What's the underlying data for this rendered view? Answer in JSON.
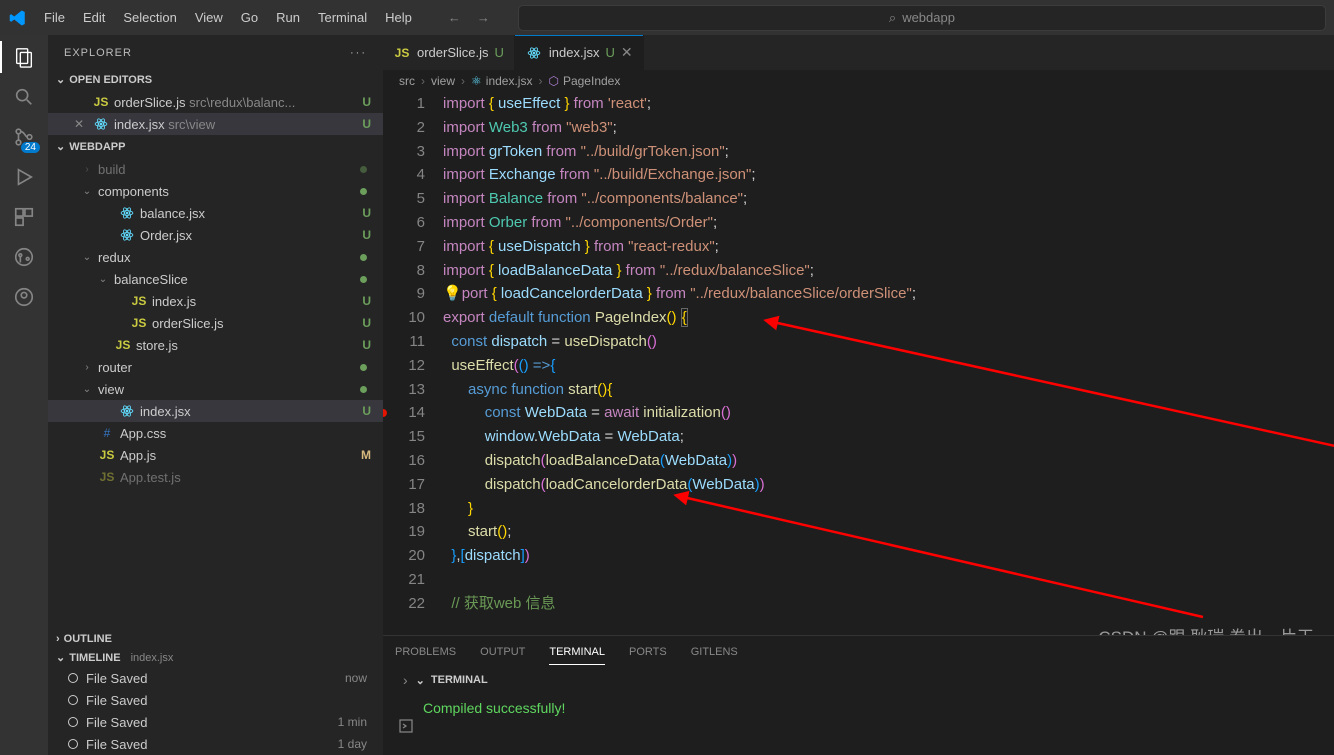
{
  "menubar": [
    "File",
    "Edit",
    "Selection",
    "View",
    "Go",
    "Run",
    "Terminal",
    "Help"
  ],
  "search": {
    "placeholder": "webdapp"
  },
  "activity": {
    "badge": "24"
  },
  "explorer": {
    "title": "EXPLORER",
    "sections": {
      "open_editors": "OPEN EDITORS",
      "workspace": "WEBDAPP",
      "outline": "OUTLINE",
      "timeline": "TIMELINE",
      "timeline_file": "index.jsx"
    },
    "open_items": [
      {
        "icon": "js",
        "name": "orderSlice.js",
        "path": "src\\redux\\balanc...",
        "status": "U"
      },
      {
        "icon": "react",
        "name": "index.jsx",
        "path": "src\\view",
        "status": "U",
        "close": true
      }
    ],
    "tree": [
      {
        "pad": 32,
        "chev": ">",
        "name": "build",
        "dim": true,
        "dot": true
      },
      {
        "pad": 32,
        "chev": "v",
        "name": "components",
        "dot": true
      },
      {
        "pad": 52,
        "icon": "react",
        "name": "balance.jsx",
        "status": "U"
      },
      {
        "pad": 52,
        "icon": "react",
        "name": "Order.jsx",
        "status": "U"
      },
      {
        "pad": 32,
        "chev": "v",
        "name": "redux",
        "dot": true
      },
      {
        "pad": 48,
        "chev": "v",
        "name": "balanceSlice",
        "dot": true
      },
      {
        "pad": 64,
        "icon": "js",
        "name": "index.js",
        "status": "U"
      },
      {
        "pad": 64,
        "icon": "js",
        "name": "orderSlice.js",
        "status": "U"
      },
      {
        "pad": 48,
        "icon": "js",
        "name": "store.js",
        "status": "U"
      },
      {
        "pad": 32,
        "chev": ">",
        "name": "router",
        "dot": true
      },
      {
        "pad": 32,
        "chev": "v",
        "name": "view",
        "dot": true
      },
      {
        "pad": 52,
        "icon": "react",
        "name": "index.jsx",
        "status": "U",
        "selected": true
      },
      {
        "pad": 32,
        "icon": "css",
        "name": "App.css"
      },
      {
        "pad": 32,
        "icon": "js",
        "name": "App.js",
        "status": "M"
      },
      {
        "pad": 32,
        "icon": "js",
        "name": "App.test.js",
        "dim": true
      }
    ],
    "timeline": [
      {
        "label": "File Saved",
        "ts": "now"
      },
      {
        "label": "File Saved",
        "ts": ""
      },
      {
        "label": "File Saved",
        "ts": "1 min"
      },
      {
        "label": "File Saved",
        "ts": "1 day"
      }
    ]
  },
  "tabs": [
    {
      "icon": "js",
      "name": "orderSlice.js",
      "mod": "U"
    },
    {
      "icon": "react",
      "name": "index.jsx",
      "mod": "U",
      "active": true
    }
  ],
  "breadcrumbs": [
    "src",
    "view",
    "index.jsx",
    "PageIndex"
  ],
  "code_lines": 22,
  "panel": {
    "tabs": [
      "PROBLEMS",
      "OUTPUT",
      "TERMINAL",
      "PORTS",
      "GITLENS"
    ],
    "active": "TERMINAL",
    "section": "TERMINAL",
    "output": "Compiled successfully!"
  },
  "watermark": "CSDN @跟 耿瑞 卷出一片天"
}
